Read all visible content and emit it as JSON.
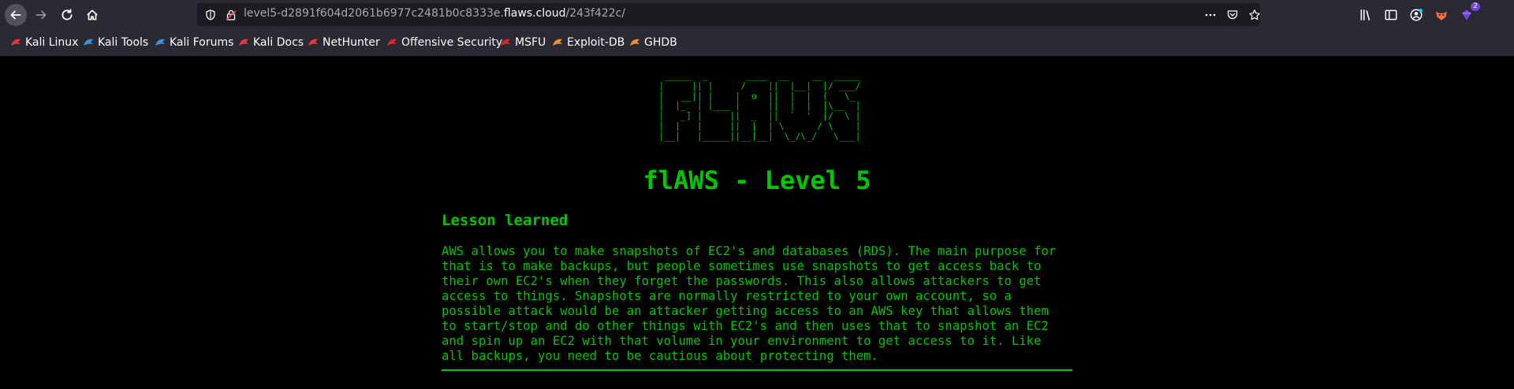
{
  "browser": {
    "url_prefix": "level5-d2891f604d2061b6977c2481b0c8333e.",
    "url_domain": "flaws.cloud",
    "url_path": "/243f422c/",
    "badge_count": "2"
  },
  "bookmarks": [
    {
      "label": "Kali Linux",
      "icon": "kali-dragon-icon",
      "color": "#e63838"
    },
    {
      "label": "Kali Tools",
      "icon": "kali-tools-icon",
      "color": "#3d8fe0"
    },
    {
      "label": "Kali Forums",
      "icon": "kali-forums-icon",
      "color": "#3d8fe0"
    },
    {
      "label": "Kali Docs",
      "icon": "kali-docs-icon",
      "color": "#e63838"
    },
    {
      "label": "NetHunter",
      "icon": "nethunter-icon",
      "color": "#e63838"
    },
    {
      "label": "Offensive Security",
      "icon": "offsec-icon",
      "color": "#d92626"
    },
    {
      "label": "MSFU",
      "icon": "msfu-icon",
      "color": "#d92626"
    },
    {
      "label": "Exploit-DB",
      "icon": "exploit-db-icon",
      "color": "#e8922e"
    },
    {
      "label": "GHDB",
      "icon": "ghdb-icon",
      "color": "#e8922e"
    }
  ],
  "page": {
    "ascii_art": "  _____  _       ____  __    __  _____\n |     || |     /    ||  |__|  |/ ___/\n |   __|| |    |  o  ||  |  |  (   \\_ \n |  |_  | |___ |     ||  |  |  |\\__  |\n |   _] |     ||  _  ||  `  '  |/  \\ |\n |  |   |     ||  |  | \\      / \\    |\n |__|   |_____||__|__|  \\_/\\_/   \\___|",
    "title": "flAWS - Level 5",
    "lesson_heading": "Lesson learned",
    "lesson_text": "AWS allows you to make snapshots of EC2's and databases (RDS). The main purpose for\nthat is to make backups, but people sometimes use snapshots to get access back to\ntheir own EC2's when they forget the passwords. This also allows attackers to get\naccess to things. Snapshots are normally restricted to your own account, so a\npossible attack would be an attacker getting access to an AWS key that allows them\nto start/stop and do other things with EC2's and then uses that to snapshot an EC2\nand spin up an EC2 with that volume in your environment to get access to it. Like\nall backups, you need to be cautious about protecting them.",
    "text_color": "#00c800"
  }
}
